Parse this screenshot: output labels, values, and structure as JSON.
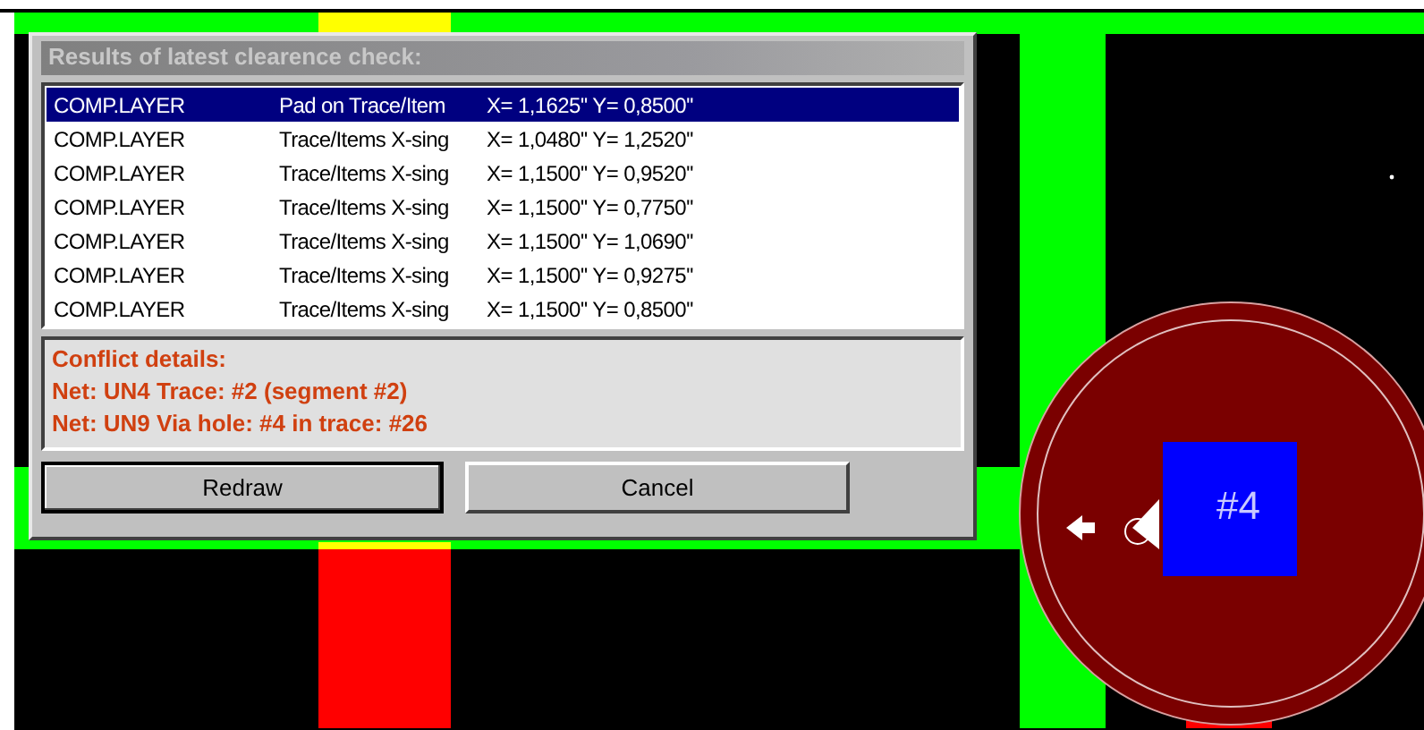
{
  "dialog": {
    "title": "Results of latest clearence check:",
    "rows": [
      {
        "layer": "COMP.LAYER",
        "type": "Pad on Trace/Item",
        "coords": "X= 1,1625'' Y= 0,8500''",
        "selected": true
      },
      {
        "layer": "COMP.LAYER",
        "type": "Trace/Items X-sing",
        "coords": "X= 1,0480'' Y= 1,2520''",
        "selected": false
      },
      {
        "layer": "COMP.LAYER",
        "type": "Trace/Items X-sing",
        "coords": "X= 1,1500'' Y= 0,9520''",
        "selected": false
      },
      {
        "layer": "COMP.LAYER",
        "type": "Trace/Items X-sing",
        "coords": "X= 1,1500'' Y= 0,7750''",
        "selected": false
      },
      {
        "layer": "COMP.LAYER",
        "type": "Trace/Items X-sing",
        "coords": "X= 1,1500'' Y= 1,0690''",
        "selected": false
      },
      {
        "layer": "COMP.LAYER",
        "type": "Trace/Items X-sing",
        "coords": "X= 1,1500'' Y= 0,9275''",
        "selected": false
      },
      {
        "layer": "COMP.LAYER",
        "type": "Trace/Items X-sing",
        "coords": "X= 1,1500'' Y= 0,8500''",
        "selected": false
      }
    ],
    "details": [
      "Conflict details:",
      "Net: UN4 Trace: #2 (segment #2)",
      "Net: UN9 Via hole:  #4 in trace:  #26"
    ],
    "buttons": [
      {
        "label": "Redraw",
        "default": true
      },
      {
        "label": "Cancel",
        "default": false
      }
    ]
  },
  "board": {
    "pad_label": "#4"
  }
}
